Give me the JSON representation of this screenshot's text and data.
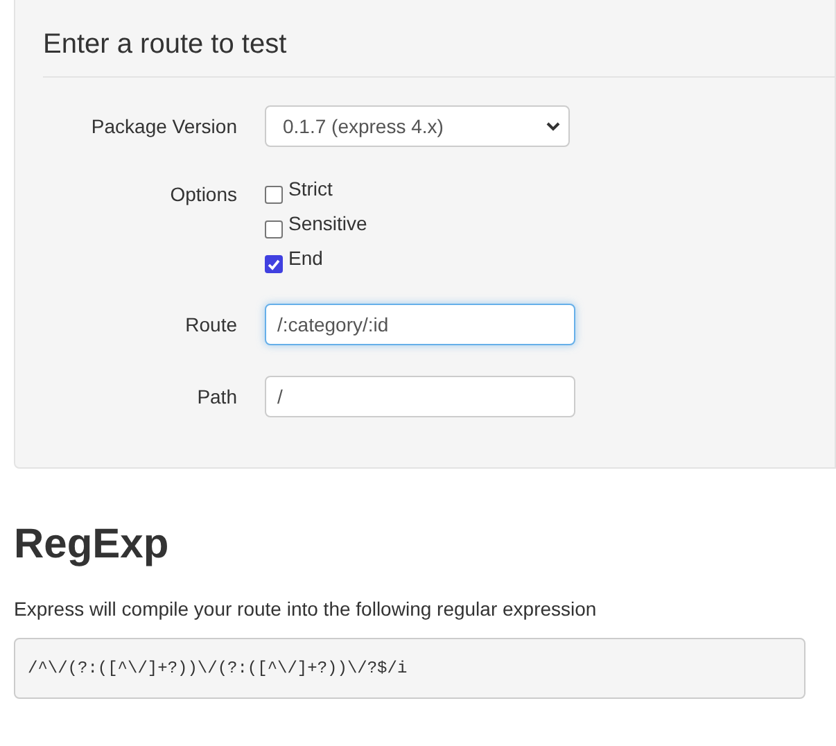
{
  "form": {
    "title": "Enter a route to test",
    "rows": [
      {
        "kind": "select",
        "label": "Package Version",
        "value": "0.1.7 (express 4.x)"
      },
      {
        "kind": "checkboxes",
        "label": "Options",
        "options": [
          {
            "label": "Strict",
            "checked": false
          },
          {
            "label": "Sensitive",
            "checked": false
          },
          {
            "label": "End",
            "checked": true
          }
        ]
      },
      {
        "kind": "input",
        "label": "Route",
        "value": "/:category/:id",
        "focused": true
      },
      {
        "kind": "input",
        "label": "Path",
        "value": "/",
        "focused": false
      }
    ]
  },
  "result": {
    "title": "RegExp",
    "description": "Express will compile your route into the following regular expression",
    "regexp": "/^\\/(?:([^\\/]+?))\\/(?:([^\\/]+?))\\/?$/i"
  }
}
